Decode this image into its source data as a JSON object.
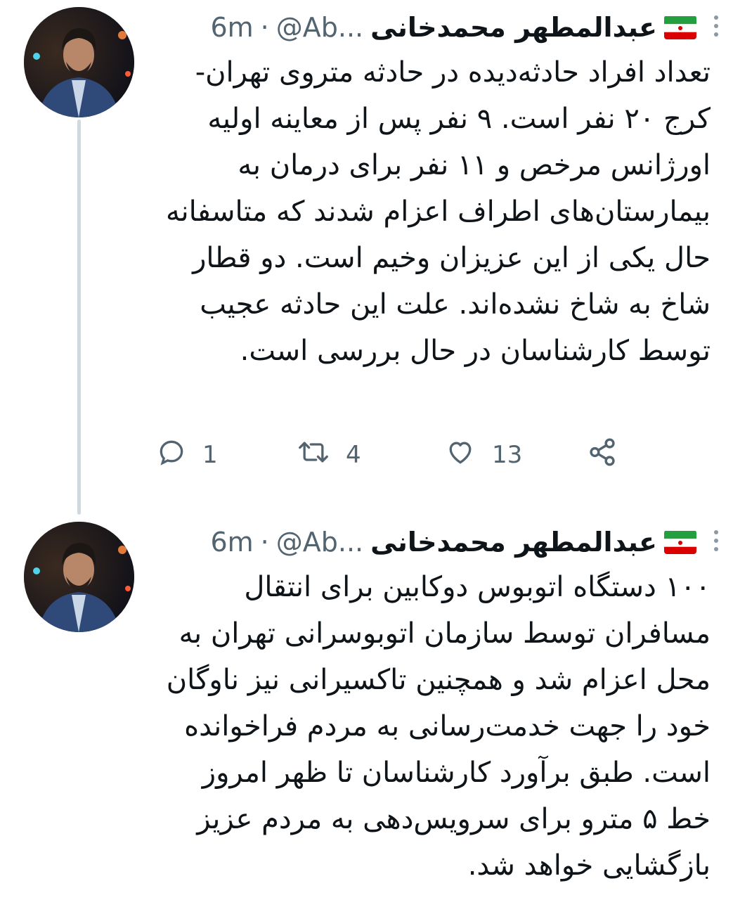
{
  "tweets": [
    {
      "display_name": "عبدالمطهر محمدخانی",
      "handle": "@Ab...",
      "separator": "·",
      "time": "6m",
      "flag_icon": "iran-flag-icon",
      "text": "تعداد افراد حادثه‌دیده در حادثه متروی تهران-کرج ۲۰ نفر است. ۹ نفر پس از معاینه اولیه اورژانس مرخص و ۱۱ نفر برای درمان به بیمارستان‌های اطراف اعزام شدند که متاسفانه حال یکی از این عزیزان وخیم است. دو قطار شاخ به شاخ نشده‌اند. علت این حادثه عجیب توسط کارشناسان در حال بررسی است.",
      "reply_count": "1",
      "retweet_count": "4",
      "like_count": "13"
    },
    {
      "display_name": "عبدالمطهر محمدخانی",
      "handle": "@Ab...",
      "separator": "·",
      "time": "6m",
      "flag_icon": "iran-flag-icon",
      "text": "۱۰۰ دستگاه اتوبوس دوکابین برای انتقال مسافران توسط سازمان اتوبوسرانی تهران به محل اعزام شد و همچنین تاکسیرانی نیز ناوگان خود را جهت خدمت‌رسانی به مردم فراخوانده است. طبق برآورد کارشناسان تا ظهر امروز خط ۵ مترو برای سرویس‌دهی به مردم عزیز بازگشایی خواهد شد."
    }
  ],
  "icons": {
    "more": "more-vertical-icon",
    "reply": "reply-icon",
    "retweet": "retweet-icon",
    "like": "heart-icon",
    "share": "share-icon"
  },
  "colors": {
    "text": "#0f1419",
    "secondary": "#536471",
    "thread_line": "#cfd9de"
  }
}
